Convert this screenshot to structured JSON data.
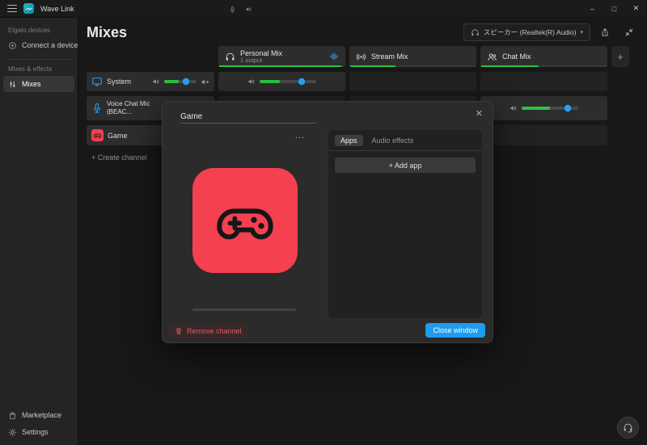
{
  "colors": {
    "accent_blue": "#1f9bf0",
    "meter_green": "#2bc246",
    "game_red": "#f4404f",
    "danger_red": "#e05c5c"
  },
  "titlebar": {
    "app_name": "Wave Link",
    "minimize_glyph": "–",
    "maximize_glyph": "□",
    "close_glyph": "✕"
  },
  "sidebar": {
    "devices_section_label": "Elgato devices",
    "connect_device_label": "Connect a device",
    "mixes_section_label": "Mixes & effects",
    "mixes_label": "Mixes",
    "marketplace_label": "Marketplace",
    "settings_label": "Settings"
  },
  "header": {
    "title": "Mixes",
    "output_device": "スピーカー (Realtek(R) Audio)",
    "chevron_glyph": "▾"
  },
  "mix_columns": [
    {
      "name": "Personal Mix",
      "subtitle": "1 output",
      "meter_style": "width:97%"
    },
    {
      "name": "Stream Mix",
      "meter_style": "width:36%"
    },
    {
      "name": "Chat Mix",
      "meter_style": "width:46%"
    }
  ],
  "add_mix_glyph": "+",
  "channels": {
    "system": {
      "name": "System",
      "label_meter_style": "width:46%",
      "label_thumb_style": "left:68%",
      "personal_meter_style": "width:36%",
      "personal_thumb_style": "left:74%"
    },
    "voice_chat": {
      "name": "Voice Chat Mic (BEAC...",
      "label_meter_style": "width:40%",
      "label_thumb_style": "left:62%",
      "chat_meter_style": "width:50%",
      "chat_thumb_style": "left:82%"
    },
    "game": {
      "name": "Game"
    }
  },
  "create_channel_label": "+  Create channel",
  "modal": {
    "name_value": "Game",
    "close_glyph": "✕",
    "more_glyph": "...",
    "tab_apps": "Apps",
    "tab_audio_effects": "Audio effects",
    "add_app_label": "+  Add app",
    "remove_channel_label": "Remove channel",
    "close_window_label": "Close window"
  }
}
